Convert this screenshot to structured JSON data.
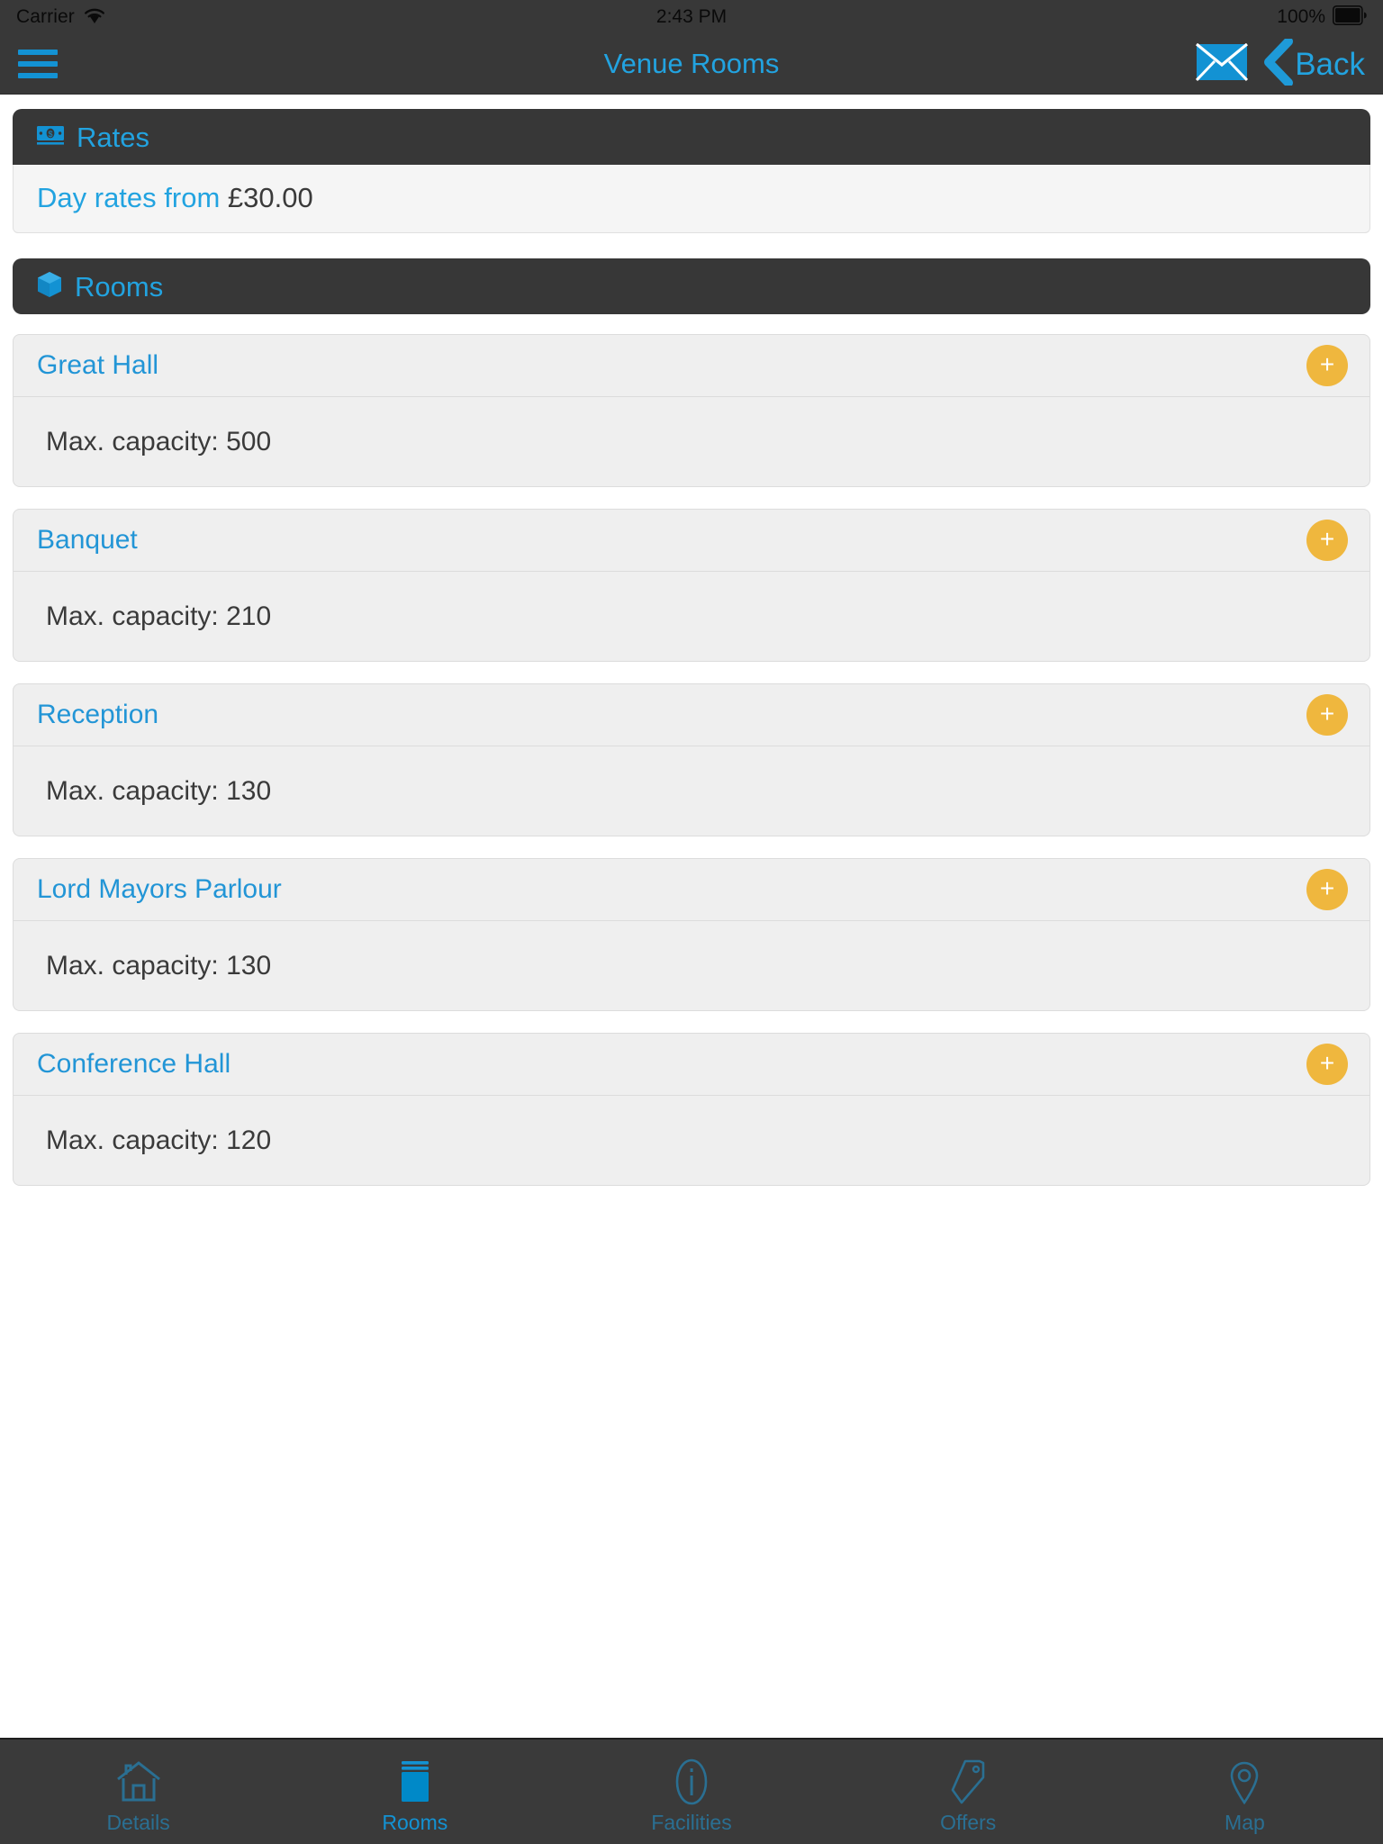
{
  "status_bar": {
    "carrier": "Carrier",
    "time": "2:43 PM",
    "battery_percent": "100%",
    "wifi_icon": "wifi-icon",
    "battery_icon": "battery-icon"
  },
  "nav_bar": {
    "menu_icon": "hamburger-menu-icon",
    "title": "Venue Rooms",
    "mail_icon": "envelope-icon",
    "back_icon": "back-chevron-icon",
    "back_label": "Back"
  },
  "rates_section": {
    "icon": "money-banknote-icon",
    "title": "Rates",
    "day_rates_label": "Day rates from",
    "day_rates_value": "£30.00"
  },
  "rooms_section": {
    "icon": "cube-box-icon",
    "title": "Rooms",
    "add_icon": "plus-icon",
    "rooms": [
      {
        "name": "Great Hall",
        "capacity": "Max. capacity: 500"
      },
      {
        "name": "Banquet",
        "capacity": "Max. capacity: 210"
      },
      {
        "name": "Reception",
        "capacity": "Max. capacity: 130"
      },
      {
        "name": "Lord Mayors Parlour",
        "capacity": "Max. capacity: 130"
      },
      {
        "name": "Conference Hall",
        "capacity": "Max. capacity: 120"
      }
    ]
  },
  "tab_bar": {
    "items": [
      {
        "label": "Details",
        "icon": "house-icon",
        "active": false
      },
      {
        "label": "Rooms",
        "icon": "bed-icon",
        "active": true
      },
      {
        "label": "Facilities",
        "icon": "info-circle-icon",
        "active": false
      },
      {
        "label": "Offers",
        "icon": "tag-icon",
        "active": false
      },
      {
        "label": "Map",
        "icon": "map-pin-icon",
        "active": false
      }
    ]
  },
  "colors": {
    "accent_blue": "#22a3e0",
    "link_blue": "#2295d6",
    "amber": "#efb73e",
    "bar_dark": "#383838",
    "card_grey": "#efefef",
    "tab_inactive": "#2a6f92"
  }
}
